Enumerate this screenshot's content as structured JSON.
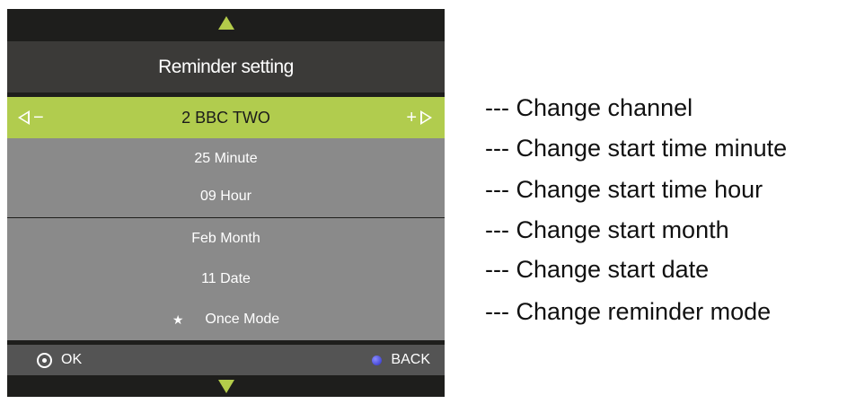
{
  "menu": {
    "title": "Reminder setting",
    "rows": [
      {
        "label": "2 BBC TWO"
      },
      {
        "label": "25 Minute"
      },
      {
        "label": "09 Hour"
      },
      {
        "label": "Feb Month"
      },
      {
        "label": "11 Date"
      },
      {
        "label": "Once Mode"
      }
    ],
    "footer": {
      "ok_label": "OK",
      "back_label": "BACK"
    },
    "icons": {
      "scroll_up": "triangle-up-icon",
      "scroll_down": "triangle-down-icon",
      "decrease": "triangle-left-minus-icon",
      "increase": "plus-triangle-right-icon",
      "mode": "star-icon",
      "ok": "circle-dot-icon",
      "back": "blue-dot-icon"
    },
    "colors": {
      "accent": "#b1cc4e",
      "row_background": "#8a8a8a",
      "header_background": "#3b3a38",
      "frame_background": "#1e1e1c",
      "footer_background": "#545454",
      "back_button": "#3436d0"
    }
  },
  "annotations": [
    {
      "text": "--- Change channel"
    },
    {
      "text": "--- Change start time minute"
    },
    {
      "text": "--- Change start time hour"
    },
    {
      "text": "--- Change start month"
    },
    {
      "text": "--- Change start date"
    },
    {
      "text": "--- Change reminder mode"
    }
  ]
}
